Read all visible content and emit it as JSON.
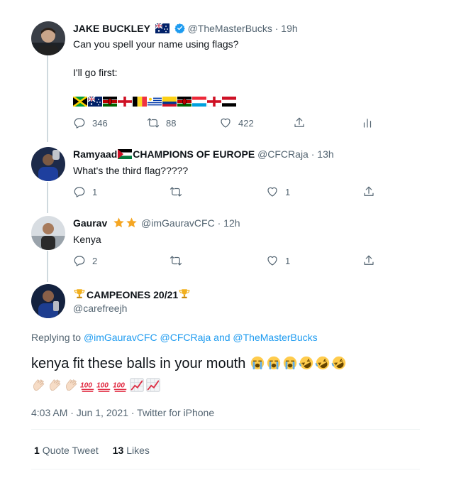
{
  "tweets": [
    {
      "name": "JAKE BUCKLEY",
      "handle": "@TheMasterBucks",
      "time": "19h",
      "line1": "Can you spell your name using flags?",
      "line2": "I'll go first:",
      "reply_count": "346",
      "retweet_count": "88",
      "like_count": "422"
    },
    {
      "name_prefix": "Ramyaad",
      "name_suffix": "CHAMPIONS OF EUROPE",
      "handle": "@CFCRaja",
      "time": "13h",
      "text": "What's the third flag?????",
      "reply_count": "1",
      "like_count": "1"
    },
    {
      "name": "Gaurav",
      "handle": "@imGauravCFC",
      "time": "12h",
      "text": "Kenya",
      "reply_count": "2",
      "like_count": "1"
    }
  ],
  "main": {
    "name": "CAMPEONES 20/21",
    "handle": "@carefreejh",
    "replying_prefix": "Replying to",
    "replying_to": "@imGauravCFC @CFCRaja and @TheMasterBucks",
    "text": "kenya fit these balls in your mouth",
    "timestamp": "4:03 AM · Jun 1, 2021 · Twitter for iPhone",
    "quote_count": "1",
    "quote_label": "Quote Tweet",
    "likes_count": "13",
    "likes_label": "Likes"
  },
  "dot": "·",
  "colors": {
    "link": "#1d9bf0",
    "secondary": "#536471",
    "verified": "#1d9bf0"
  }
}
